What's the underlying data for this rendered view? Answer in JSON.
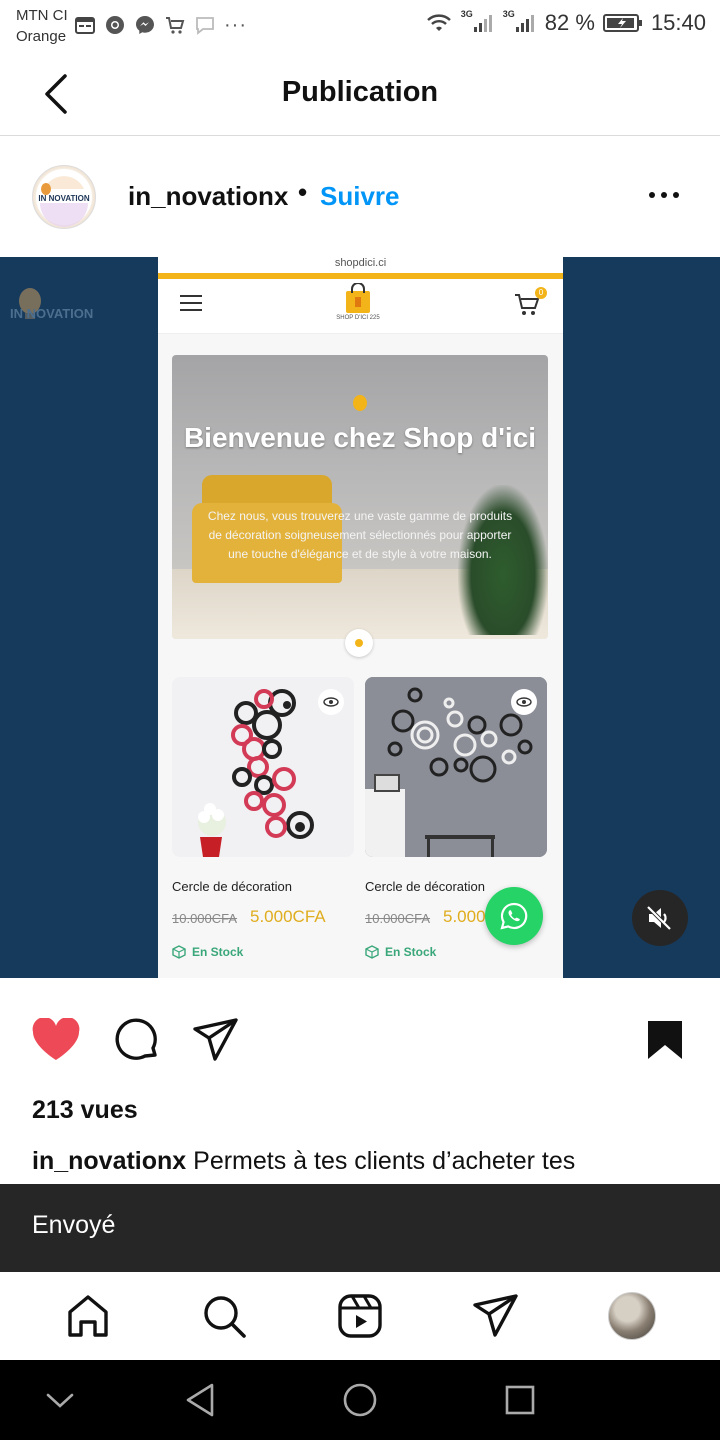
{
  "status_bar": {
    "carrier_line1": "MTN CI",
    "carrier_line2": "Orange",
    "network_1": "3G",
    "network_2": "3G",
    "battery": "82 %",
    "time": "15:40",
    "icons": [
      "calendar-icon",
      "chrome-icon",
      "messenger-icon",
      "cart-icon",
      "chat-icon",
      "more-dots-icon",
      "wifi-icon",
      "signal-icon",
      "battery-icon"
    ]
  },
  "header": {
    "title": "Publication"
  },
  "post": {
    "username": "in_novationx",
    "separator": "•",
    "follow_label": "Suivre",
    "avatar_text": "IN NOVATION"
  },
  "media": {
    "watermark": "IN NOVATION",
    "browser_url": "shopdici.ci",
    "shop_logo_text": "SHOP D'ICI 225",
    "cart_count": "0",
    "hero_title": "Bienvenue chez Shop d'ici",
    "hero_subtitle": "Chez nous, vous trouverez une vaste gamme de produits de décoration soigneusement sélectionnés pour apporter une touche d'élégance et de style à votre maison.",
    "products": [
      {
        "title": "Cercle de décoration",
        "old_price": "10.000CFA",
        "new_price": "5.000CFA",
        "stock": "En Stock"
      },
      {
        "title": "Cercle de décoration",
        "old_price": "10.000CFA",
        "new_price": "5.000",
        "stock": "En Stock"
      }
    ]
  },
  "stats": {
    "views": "213 vues"
  },
  "caption": {
    "username": "in_novationx",
    "text": "Permets à tes clients d’acheter tes"
  },
  "toast": {
    "text": "Envoyé"
  },
  "colors": {
    "accent": "#0095f6",
    "like": "#ed4956",
    "media_bg": "#163a5c",
    "shop_yellow": "#f2b418",
    "whatsapp": "#25d366"
  }
}
